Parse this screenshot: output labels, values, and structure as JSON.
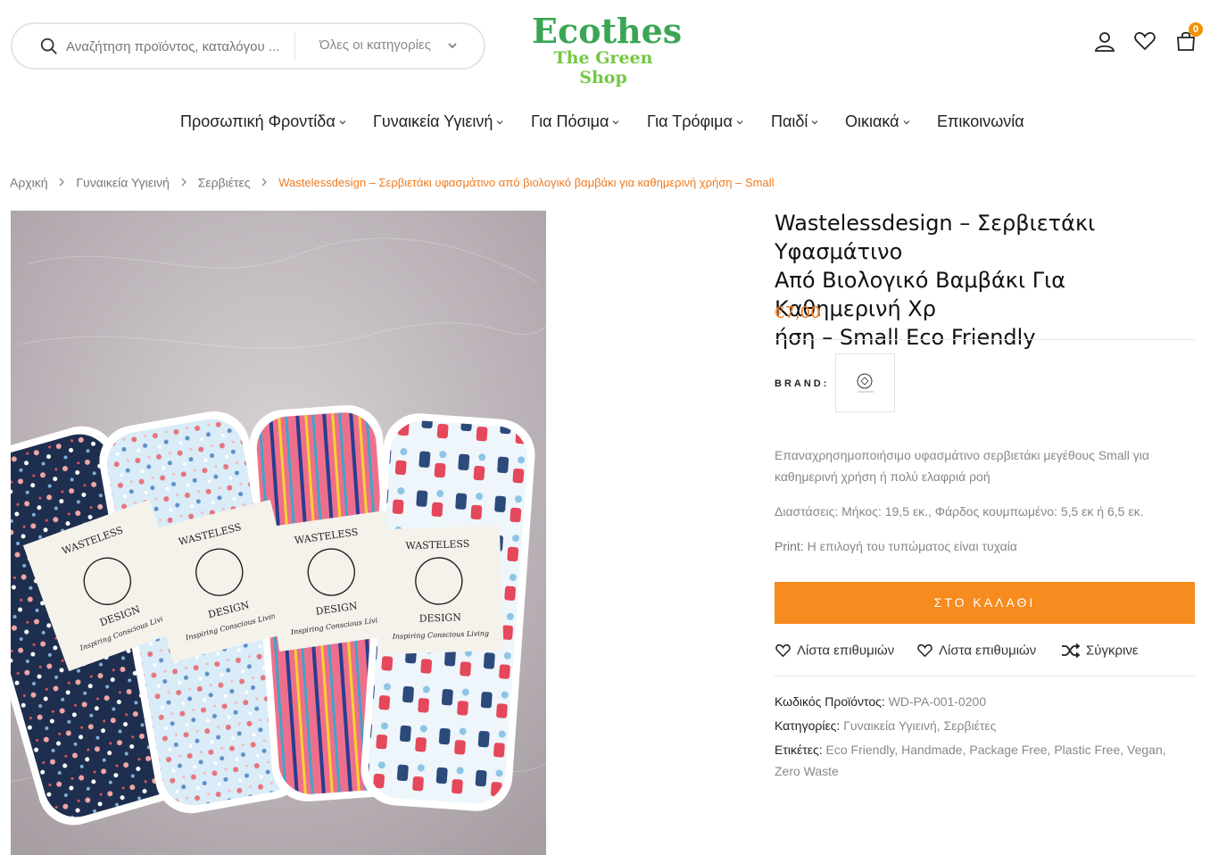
{
  "header": {
    "search": {
      "placeholder": "Αναζήτηση προϊόντος, καταλόγου ...",
      "category": "Όλες οι κατηγορίες"
    },
    "logo": {
      "line1": "Ecothes",
      "line2": "The Green Shop"
    },
    "cart_count": "0"
  },
  "nav": {
    "items": [
      {
        "label": "Προσωπική Φροντίδα"
      },
      {
        "label": "Γυναικεία Υγιεινή"
      },
      {
        "label": "Για Πόσιμα"
      },
      {
        "label": "Για Τρόφιμα"
      },
      {
        "label": "Παιδί"
      },
      {
        "label": "Οικιακά"
      },
      {
        "label": "Επικοινωνία"
      }
    ]
  },
  "breadcrumb": {
    "home": "Αρχική",
    "level1": "Γυναικεία Υγιεινή",
    "level2": "Σερβιέτες",
    "current": "Wastelessdesign – Σερβιετάκι υφασμάτινο από βιολογικό βαμβάκι για καθημερινή χρήση – Small"
  },
  "product": {
    "title_line1": "Wastelessdesign – Σερβιετάκι Υφασμάτινο",
    "title_line2": "Από Βιολογικό Βαμβάκι Για Καθημερινή Χρ",
    "title_line3": "ήση – Small Eco Friendly",
    "price": "€7,00",
    "brand_label": "BRAND:",
    "desc1_line1": "Επαναχρησημοποιήσιμο υφασμάτινο σερβιετάκι μεγέθους Small για",
    "desc1_line2": "καθημερινή χρήση ή πολύ ελαφριά ροή",
    "desc2": "Διαστάσεις: Μήκος: 19,5 εκ., Φάρδος κουμπωμένο: 5,5 εκ ή 6,5 εκ.",
    "print_label": "Print:",
    "print_value": "Η επιλογή του τυπώματος είναι τυχαία",
    "add_to_cart": "ΣΤΟ ΚΑΛΑΘΙ",
    "wishlist1": "Λίστα επιθυμιών",
    "wishlist2": "Λίστα επιθυμιών",
    "compare": "Σύγκρινε",
    "sku_label": "Κωδικός Προϊόντος:",
    "sku": "WD-PA-001-0200",
    "categories_label": "Κατηγορίες:",
    "categories": [
      "Γυναικεία Υγιεινή",
      "Σερβιέτες"
    ],
    "tags_label": "Ετικέτες:",
    "tags": [
      "Eco Friendly",
      "Handmade",
      "Package Free",
      "Plastic Free",
      "Vegan",
      "Zero Waste"
    ]
  },
  "image": {
    "band_text": [
      "WASTELESS",
      "DESIGN",
      "Inspiring Conscious Living"
    ]
  },
  "colors": {
    "accent": "#f68b1f",
    "price": "#ef7a1f",
    "logo_green": "#3aa655"
  }
}
